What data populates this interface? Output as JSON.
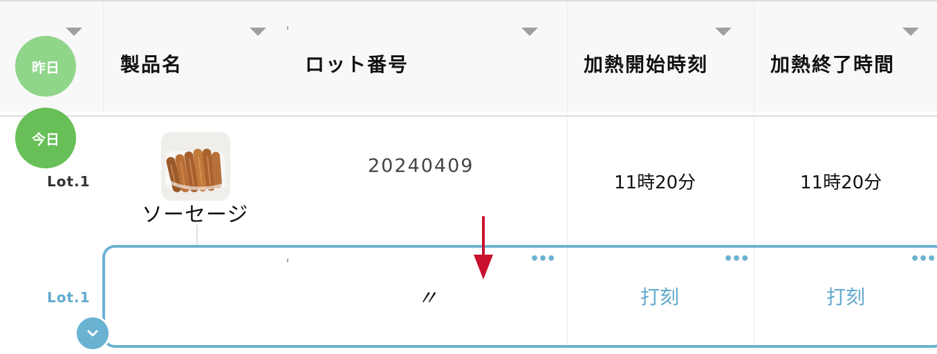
{
  "header": {
    "columns": [
      {
        "label": ""
      },
      {
        "label": "製品名"
      },
      {
        "label": "ロット番号"
      },
      {
        "label": "加熱開始時刻"
      },
      {
        "label": "加熱終了時間"
      }
    ]
  },
  "badges": {
    "yesterday": "昨日",
    "today": "今日"
  },
  "current_row": {
    "lot_label": "Lot.1",
    "product_name": "ソーセージ",
    "lot_number": "20240409",
    "heating_start": "11時20分",
    "heating_end": "11時20分"
  },
  "next_row": {
    "lot_label": "Lot.1",
    "ditto_mark": "〃",
    "stamp_label_start": "打刻",
    "stamp_label_end": "打刻"
  },
  "colors": {
    "yesterday_badge": "#8fd58a",
    "today_badge": "#68bf58",
    "accent_blue": "#6ab2d2",
    "arrow_red": "#c8102e",
    "header_background": "#f8f8f8"
  },
  "icons": {
    "sort": "triangle-down-icon",
    "more": "more-horizontal-icon",
    "expand": "chevron-down-icon",
    "pointer": "down-arrow-icon",
    "product": "sausage-image-icon"
  }
}
